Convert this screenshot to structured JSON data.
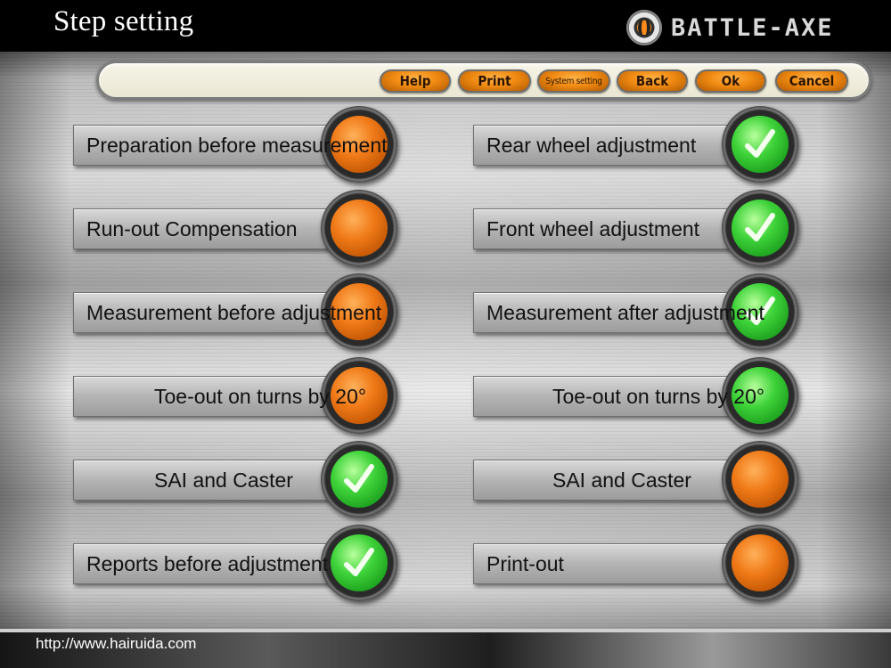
{
  "window": {
    "title": "Step setting",
    "brand": "BATTLE-AXE"
  },
  "toolbar": {
    "help": "Help",
    "print": "Print",
    "system": "System setting",
    "back": "Back",
    "ok": "Ok",
    "cancel": "Cancel"
  },
  "steps": {
    "left": [
      {
        "label": "Preparation before measurement",
        "status": "orange"
      },
      {
        "label": "Run-out Compensation",
        "status": "orange"
      },
      {
        "label": "Measurement before adjustment",
        "status": "orange"
      },
      {
        "label": "Toe-out on turns by 20°",
        "status": "orange"
      },
      {
        "label": "SAI and Caster",
        "status": "green-check"
      },
      {
        "label": "Reports before adjustment",
        "status": "green-check"
      }
    ],
    "right": [
      {
        "label": "Rear wheel adjustment",
        "status": "green-check"
      },
      {
        "label": "Front wheel adjustment",
        "status": "green-check"
      },
      {
        "label": "Measurement after adjustment",
        "status": "green-check"
      },
      {
        "label": "Toe-out on turns by 20°",
        "status": "green"
      },
      {
        "label": "SAI and Caster",
        "status": "orange"
      },
      {
        "label": "Print-out",
        "status": "orange"
      }
    ]
  },
  "colors": {
    "lamp_orange": "#f07a18",
    "lamp_green": "#3fd33a",
    "toolbar_button": "#f08a12"
  },
  "footer": {
    "url": "http://www.hairuida.com"
  }
}
